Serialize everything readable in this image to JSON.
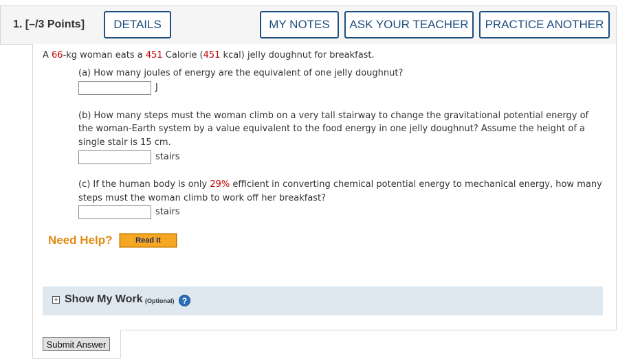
{
  "header": {
    "question_number": "1.",
    "points": "[–/3 Points]",
    "details_label": "DETAILS",
    "my_notes_label": "MY NOTES",
    "ask_teacher_label": "ASK YOUR TEACHER",
    "practice_another_label": "PRACTICE ANOTHER"
  },
  "problem": {
    "intro_a": "A ",
    "mass": "66",
    "intro_b": "-kg woman eats a ",
    "calories": "451",
    "intro_c": " Calorie (",
    "kcal": "451",
    "intro_d": " kcal) jelly doughnut for breakfast.",
    "part_a": "(a) How many joules of energy are the equivalent of one jelly doughnut?",
    "part_a_unit": "J",
    "part_b_line1": "(b) How many steps must the woman climb on a very tall stairway to change the gravitational potential energy of",
    "part_b_line2": "the woman-Earth system by a value equivalent to the food energy in one jelly doughnut? Assume the height of a",
    "part_b_line3": "single stair is 15 cm.",
    "part_b_unit": "stairs",
    "part_c_pre": "(c) If the human body is only ",
    "efficiency": "29%",
    "part_c_post": " efficient in converting chemical potential energy to mechanical energy, how many",
    "part_c_line2": "steps must the woman climb to work off her breakfast?",
    "part_c_unit": "stairs"
  },
  "help": {
    "need_help_label": "Need Help?",
    "read_it_label": "Read It"
  },
  "show_work": {
    "toggle_symbol": "+",
    "label": "Show My Work",
    "optional": "(Optional)",
    "help_symbol": "?"
  },
  "submit_label": "Submit Answer",
  "colors": {
    "accent_blue": "#1e4f80",
    "highlight_red": "#c00000",
    "need_help_orange": "#e38a12",
    "show_work_bg": "#dde8f1"
  },
  "icons": [
    "expand-plus-icon",
    "help-question-icon"
  ]
}
